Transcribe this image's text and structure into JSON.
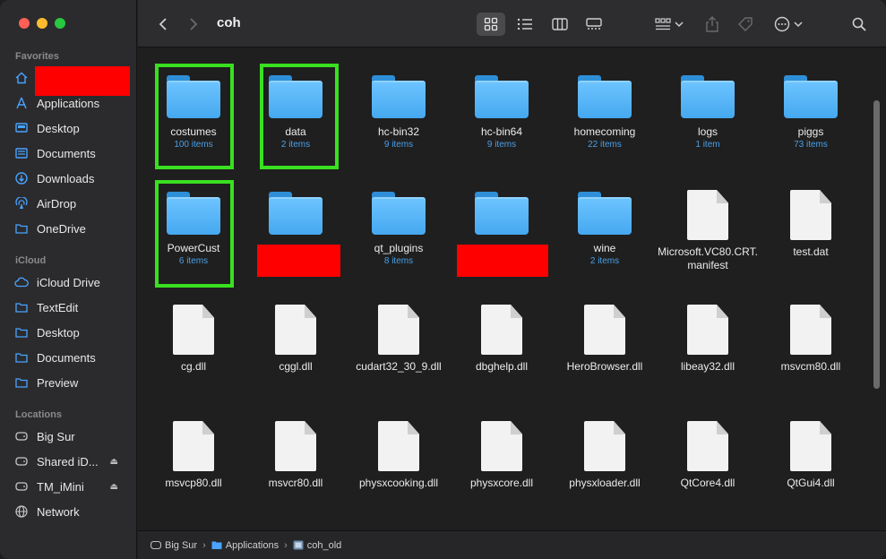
{
  "sidebar": {
    "favorites_label": "Favorites",
    "favorites": [
      {
        "label": "",
        "icon": "home-icon",
        "redacted": true
      },
      {
        "label": "Applications",
        "icon": "applications-icon"
      },
      {
        "label": "Desktop",
        "icon": "desktop-icon"
      },
      {
        "label": "Documents",
        "icon": "document-icon"
      },
      {
        "label": "Downloads",
        "icon": "downloads-icon"
      },
      {
        "label": "AirDrop",
        "icon": "airdrop-icon"
      },
      {
        "label": "OneDrive",
        "icon": "folder-icon"
      }
    ],
    "icloud_label": "iCloud",
    "icloud": [
      {
        "label": "iCloud Drive",
        "icon": "cloud-icon"
      },
      {
        "label": "TextEdit",
        "icon": "folder-icon"
      },
      {
        "label": "Desktop",
        "icon": "folder-icon"
      },
      {
        "label": "Documents",
        "icon": "folder-icon"
      },
      {
        "label": "Preview",
        "icon": "folder-icon"
      }
    ],
    "locations_label": "Locations",
    "locations": [
      {
        "label": "Big Sur",
        "icon": "disk-icon"
      },
      {
        "label": "Shared iD...",
        "icon": "disk-icon",
        "eject": true
      },
      {
        "label": "TM_iMini",
        "icon": "disk-icon",
        "eject": true
      },
      {
        "label": "Network",
        "icon": "globe-icon"
      }
    ]
  },
  "toolbar": {
    "title": "coh",
    "view_modes": [
      "icon-view",
      "list-view",
      "column-view",
      "gallery-view"
    ],
    "active_view": "icon-view"
  },
  "files": [
    {
      "name": "costumes",
      "count": "100 items",
      "kind": "folder",
      "highlight": true
    },
    {
      "name": "data",
      "count": "2 items",
      "kind": "folder",
      "highlight": true
    },
    {
      "name": "hc-bin32",
      "count": "9 items",
      "kind": "folder"
    },
    {
      "name": "hc-bin64",
      "count": "9 items",
      "kind": "folder"
    },
    {
      "name": "homecoming",
      "count": "22 items",
      "kind": "folder"
    },
    {
      "name": "logs",
      "count": "1 item",
      "kind": "folder"
    },
    {
      "name": "piggs",
      "count": "73 items",
      "kind": "folder"
    },
    {
      "name": "PowerCust",
      "count": "6 items",
      "kind": "folder",
      "highlight": true
    },
    {
      "name": "",
      "count": "",
      "kind": "folder",
      "redacted": true
    },
    {
      "name": "qt_plugins",
      "count": "8 items",
      "kind": "folder"
    },
    {
      "name": "",
      "count": "",
      "kind": "folder",
      "redacted": true
    },
    {
      "name": "wine",
      "count": "2 items",
      "kind": "folder"
    },
    {
      "name": "Microsoft.VC80.CRT.manifest",
      "count": "",
      "kind": "file"
    },
    {
      "name": "test.dat",
      "count": "",
      "kind": "file"
    },
    {
      "name": "cg.dll",
      "count": "",
      "kind": "file"
    },
    {
      "name": "cggl.dll",
      "count": "",
      "kind": "file"
    },
    {
      "name": "cudart32_30_9.dll",
      "count": "",
      "kind": "file"
    },
    {
      "name": "dbghelp.dll",
      "count": "",
      "kind": "file"
    },
    {
      "name": "HeroBrowser.dll",
      "count": "",
      "kind": "file"
    },
    {
      "name": "libeay32.dll",
      "count": "",
      "kind": "file"
    },
    {
      "name": "msvcm80.dll",
      "count": "",
      "kind": "file"
    },
    {
      "name": "msvcp80.dll",
      "count": "",
      "kind": "file"
    },
    {
      "name": "msvcr80.dll",
      "count": "",
      "kind": "file"
    },
    {
      "name": "physxcooking.dll",
      "count": "",
      "kind": "file"
    },
    {
      "name": "physxcore.dll",
      "count": "",
      "kind": "file"
    },
    {
      "name": "physxloader.dll",
      "count": "",
      "kind": "file"
    },
    {
      "name": "QtCore4.dll",
      "count": "",
      "kind": "file"
    },
    {
      "name": "QtGui4.dll",
      "count": "",
      "kind": "file"
    }
  ],
  "pathbar": {
    "crumbs": [
      "Big Sur",
      "Applications",
      "coh_old"
    ]
  },
  "colors": {
    "accent": "#4aa3ff",
    "highlight": "#39e020",
    "redact": "#ff0000"
  }
}
